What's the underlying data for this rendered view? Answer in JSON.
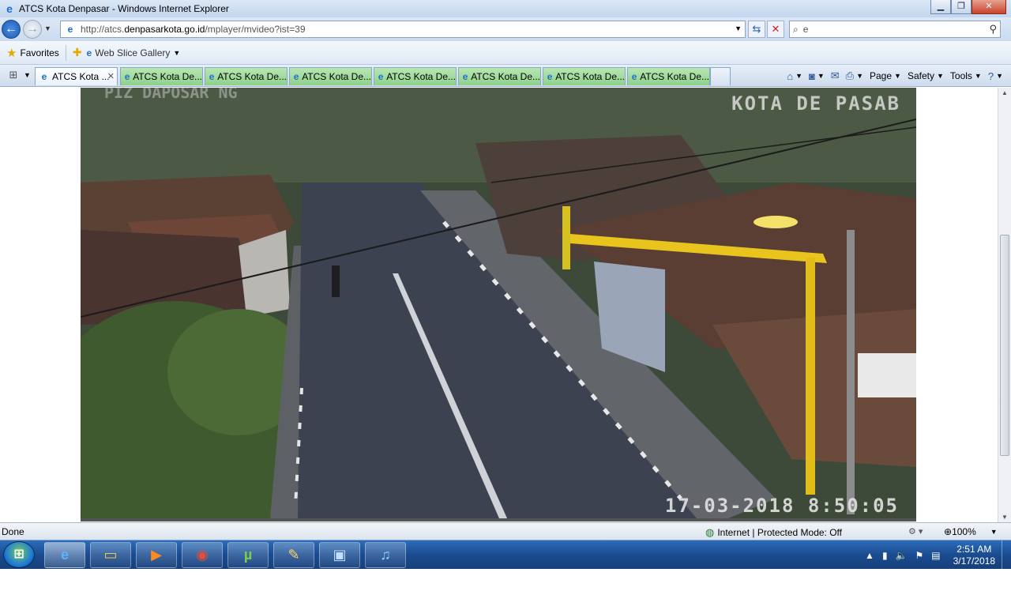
{
  "window": {
    "title": "ATCS Kota Denpasar - Windows Internet Explorer",
    "icon": "ie-icon"
  },
  "address": {
    "url_prefix": "http://atcs.",
    "url_domain": "denpasarkota.go.id",
    "url_path": "/mplayer/mvideo?ist=39"
  },
  "search": {
    "value": "e"
  },
  "favorites": {
    "label": "Favorites",
    "web_slice": "Web Slice Gallery"
  },
  "tabs": [
    {
      "label": "ATCS Kota ...",
      "active": true
    },
    {
      "label": "ATCS Kota De..."
    },
    {
      "label": "ATCS Kota De..."
    },
    {
      "label": "ATCS Kota De..."
    },
    {
      "label": "ATCS Kota De..."
    },
    {
      "label": "ATCS Kota De..."
    },
    {
      "label": "ATCS Kota De..."
    },
    {
      "label": "ATCS Kota De..."
    }
  ],
  "commands": {
    "page": "Page",
    "safety": "Safety",
    "tools": "Tools"
  },
  "camera": {
    "overlay_label": "KOTA DE PASAB",
    "overlay_label_left": "PIZ DAPOSAR NG",
    "timestamp": "17-03-2018 8:50:05"
  },
  "status": {
    "text": "Done",
    "zone": "Internet | Protected Mode: Off",
    "zoom": "100%"
  },
  "taskbar": {
    "apps": [
      "ie",
      "explorer",
      "media-player",
      "chrome",
      "utorrent",
      "paint",
      "remote-desktop",
      "itunes"
    ],
    "time": "2:51 AM",
    "date": "3/17/2018"
  },
  "colors": {
    "tab_inactive": "#8ed18a",
    "taskbar": "#1a4c90",
    "pole_yellow": "#e9c41c"
  }
}
